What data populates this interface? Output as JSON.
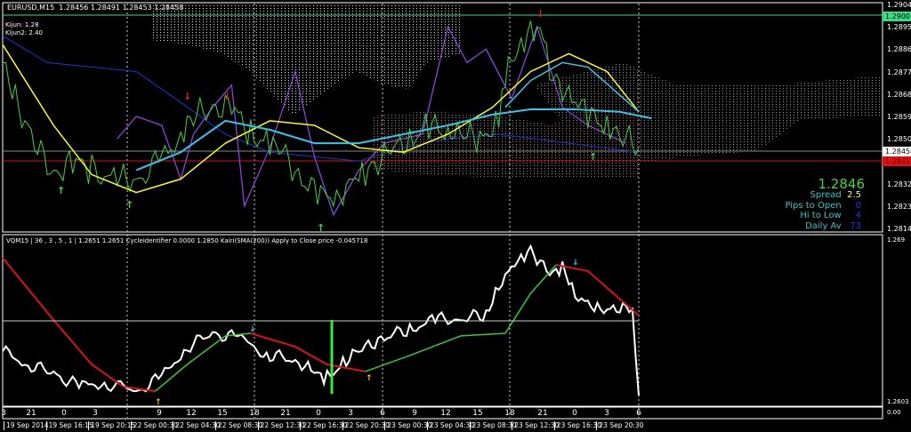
{
  "header": {
    "symbol": "EURUSD,M15",
    "open": "1.28456",
    "high": "1.28491",
    "low": "1.28453",
    "close": "1.28458",
    "line1": "Kijun: 1.28",
    "line2": "Kijun2: 2.40"
  },
  "price_axis": [
    "1.29040",
    "1.28950",
    "1.28860",
    "1.28770",
    "1.28680",
    "1.28590",
    "1.28500",
    "1.28320",
    "1.28230",
    "1.28140"
  ],
  "price_axis_markers": {
    "green_level": "1.29001",
    "bid": "1.28458",
    "red_level": "1.28418"
  },
  "info_panel": {
    "price": "1.2846",
    "spread_label": "Spread",
    "spread": "2.5",
    "pips_open_label": "Pips to Open",
    "pips_open": "0",
    "hilo_label": "Hi to Low",
    "hilo": "4",
    "daily_label": "Daily Av",
    "daily": "73"
  },
  "sub_header": "VQM15 | 36 , 3 , 5 , 1 | 1.2651 1.2651  CycleIdentifier 0.0000 1.2850  Kairi(SMA(200)) Apply to Close price -0.045718",
  "sub_axis": {
    "top": "1.269",
    "bottom": "1.2603",
    "zero": "0.00"
  },
  "hour_ticks": [
    "3",
    "21",
    "0",
    "3",
    "9",
    "12",
    "15",
    "18",
    "21",
    "0",
    "3",
    "6",
    "9",
    "12",
    "15",
    "18",
    "21",
    "0",
    "3",
    "6"
  ],
  "date_labels": [
    "19 Sep 2014",
    "19 Sep 16:15",
    "19 Sep 20:15",
    "22 Sep 00:30",
    "22 Sep 04:30",
    "22 Sep 08:30",
    "22 Sep 12:30",
    "22 Sep 16:30",
    "22 Sep 20:30",
    "23 Sep 00:30",
    "23 Sep 04:30",
    "23 Sep 08:30",
    "23 Sep 12:30",
    "23 Sep 16:30",
    "23 Sep 20:30"
  ],
  "colors": {
    "price": "#3cd83c",
    "yellow": "#ffff00",
    "cyan": "#2ec8ee",
    "blue": "#2233dd",
    "purple": "#9a44ee",
    "red": "#dd1111",
    "green_level": "#33dd88"
  },
  "chart_data": {
    "type": "line",
    "price_range": [
      1.2814,
      1.2904
    ],
    "sub_range": [
      1.2603,
      1.269
    ],
    "price": [
      [
        0,
        1.2881
      ],
      [
        2,
        1.28666
      ],
      [
        5,
        1.28486
      ],
      [
        8,
        1.2836
      ],
      [
        11,
        1.28414
      ],
      [
        14,
        1.28378
      ],
      [
        18,
        1.28342
      ],
      [
        21,
        1.28342
      ],
      [
        25,
        1.28414
      ],
      [
        28,
        1.28522
      ],
      [
        30,
        1.28594
      ],
      [
        33,
        1.2863
      ],
      [
        36,
        1.2863
      ],
      [
        39,
        1.28522
      ],
      [
        42,
        1.28486
      ],
      [
        44,
        1.2845
      ],
      [
        47,
        1.28342
      ],
      [
        50,
        1.2827
      ],
      [
        53,
        1.28288
      ],
      [
        56,
        1.28342
      ],
      [
        58,
        1.28396
      ],
      [
        61,
        1.2845
      ],
      [
        64,
        1.28504
      ],
      [
        67,
        1.28558
      ],
      [
        70,
        1.28522
      ],
      [
        72,
        1.2854
      ],
      [
        75,
        1.28486
      ],
      [
        78,
        1.28594
      ],
      [
        79,
        1.28774
      ],
      [
        81,
        1.28846
      ],
      [
        83,
        1.28954
      ],
      [
        85,
        1.28918
      ],
      [
        86,
        1.28738
      ],
      [
        89,
        1.28702
      ],
      [
        92,
        1.28594
      ],
      [
        95,
        1.28558
      ],
      [
        97,
        1.28522
      ],
      [
        100,
        1.28468
      ]
    ],
    "yellow": [
      [
        0,
        1.28882
      ],
      [
        8,
        1.28558
      ],
      [
        14,
        1.2836
      ],
      [
        21,
        1.28288
      ],
      [
        28,
        1.28342
      ],
      [
        35,
        1.28486
      ],
      [
        42,
        1.28576
      ],
      [
        49,
        1.28558
      ],
      [
        56,
        1.28468
      ],
      [
        63,
        1.2845
      ],
      [
        70,
        1.28522
      ],
      [
        77,
        1.2863
      ],
      [
        83,
        1.28774
      ],
      [
        89,
        1.28846
      ],
      [
        95,
        1.28774
      ],
      [
        100,
        1.28612
      ]
    ],
    "cyan": [
      [
        21,
        1.28378
      ],
      [
        28,
        1.2845
      ],
      [
        35,
        1.28576
      ],
      [
        42,
        1.2854
      ],
      [
        49,
        1.28486
      ],
      [
        56,
        1.28486
      ],
      [
        63,
        1.28522
      ],
      [
        70,
        1.28558
      ],
      [
        77,
        1.28601
      ],
      [
        83,
        1.28622
      ],
      [
        90,
        1.28622
      ],
      [
        97,
        1.28612
      ],
      [
        102,
        1.28586
      ]
    ],
    "cyan2": [
      [
        79,
        1.2863
      ],
      [
        83,
        1.28738
      ],
      [
        88,
        1.2881
      ],
      [
        92,
        1.28792
      ],
      [
        96,
        1.28702
      ],
      [
        100,
        1.28612
      ]
    ],
    "blue": [
      [
        0,
        1.28918
      ],
      [
        7,
        1.2881
      ],
      [
        14,
        1.28792
      ],
      [
        21,
        1.28774
      ],
      [
        28,
        1.2865
      ],
      [
        35,
        1.28522
      ],
      [
        42,
        1.2845
      ],
      [
        49,
        1.28432
      ],
      [
        56,
        1.28414
      ],
      [
        63,
        1.28468
      ],
      [
        70,
        1.28504
      ],
      [
        78,
        1.28522
      ],
      [
        89,
        1.28486
      ],
      [
        100,
        1.2845
      ]
    ],
    "purple": [
      [
        18,
        1.28504
      ],
      [
        21,
        1.28594
      ],
      [
        25,
        1.28558
      ],
      [
        28,
        1.28342
      ],
      [
        30,
        1.28522
      ],
      [
        33,
        1.2863
      ],
      [
        36,
        1.2872
      ],
      [
        38,
        1.28234
      ],
      [
        42,
        1.28468
      ],
      [
        46,
        1.28774
      ],
      [
        49,
        1.28432
      ],
      [
        52,
        1.28198
      ],
      [
        56,
        1.28378
      ],
      [
        60,
        1.28486
      ],
      [
        66,
        1.28522
      ],
      [
        70,
        1.28954
      ],
      [
        73,
        1.2881
      ],
      [
        76,
        1.28864
      ],
      [
        80,
        1.28666
      ],
      [
        84,
        1.28954
      ],
      [
        88,
        1.2863
      ],
      [
        92,
        1.28558
      ],
      [
        98,
        1.28486
      ]
    ],
    "sub_white": [
      [
        0,
        1.26302
      ],
      [
        4,
        1.26231
      ],
      [
        8,
        1.26183
      ],
      [
        12,
        1.26111
      ],
      [
        16,
        1.26135
      ],
      [
        21,
        1.26087
      ],
      [
        25,
        1.26159
      ],
      [
        29,
        1.26326
      ],
      [
        33,
        1.26398
      ],
      [
        37,
        1.26374
      ],
      [
        42,
        1.26279
      ],
      [
        46,
        1.26255
      ],
      [
        49,
        1.26183
      ],
      [
        51,
        1.26159
      ],
      [
        54,
        1.26255
      ],
      [
        57,
        1.26326
      ],
      [
        60,
        1.26374
      ],
      [
        64,
        1.26422
      ],
      [
        68,
        1.2647
      ],
      [
        72,
        1.26479
      ],
      [
        76,
        1.26494
      ],
      [
        78,
        1.26661
      ],
      [
        81,
        1.26781
      ],
      [
        83,
        1.26852
      ],
      [
        86,
        1.26709
      ],
      [
        88,
        1.26757
      ],
      [
        90,
        1.26613
      ],
      [
        93,
        1.26518
      ],
      [
        96,
        1.26542
      ],
      [
        99,
        1.26518
      ],
      [
        100,
        1.26064
      ]
    ],
    "sub_ma_red1": [
      [
        0,
        1.26804
      ],
      [
        8,
        1.2647
      ],
      [
        14,
        1.26231
      ],
      [
        19,
        1.26111
      ],
      [
        24,
        1.26087
      ]
    ],
    "sub_ma_green1": [
      [
        24,
        1.26087
      ],
      [
        29,
        1.26231
      ],
      [
        35,
        1.26384
      ],
      [
        39,
        1.26398
      ]
    ],
    "sub_ma_red2": [
      [
        39,
        1.26398
      ],
      [
        46,
        1.26326
      ],
      [
        51,
        1.26231
      ],
      [
        57,
        1.26193
      ]
    ],
    "sub_ma_green2": [
      [
        57,
        1.26193
      ],
      [
        64,
        1.26279
      ],
      [
        72,
        1.26384
      ],
      [
        79,
        1.26398
      ],
      [
        83,
        1.26613
      ],
      [
        87,
        1.26766
      ]
    ],
    "sub_ma_red3": [
      [
        87,
        1.26766
      ],
      [
        92,
        1.26733
      ],
      [
        96,
        1.26613
      ],
      [
        100,
        1.26494
      ]
    ],
    "sub_level": 1.26465
  }
}
